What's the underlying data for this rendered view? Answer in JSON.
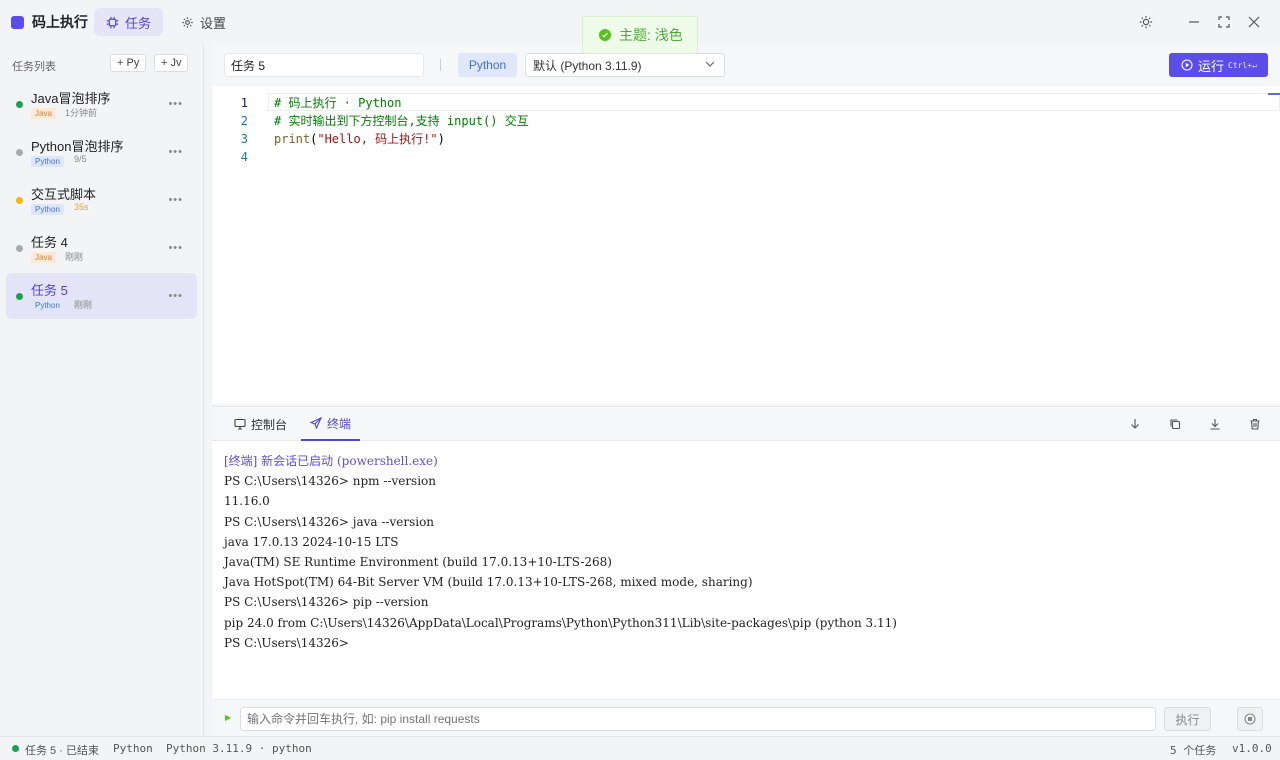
{
  "app": {
    "title": "码上执行"
  },
  "nav": {
    "tabs": [
      {
        "label": "任务",
        "icon": "cpu-icon",
        "active": true
      },
      {
        "label": "设置",
        "icon": "gear-icon",
        "active": false
      }
    ]
  },
  "toast": {
    "text": "主题: 浅色"
  },
  "sidebar": {
    "header": "任务列表",
    "add_python": "+ Py",
    "add_java": "+ Jv",
    "tasks": [
      {
        "name": "Java冒泡排序",
        "lang": "Java",
        "meta": "1分钟前",
        "status_color": "#1aa251",
        "meta_color": "#888888"
      },
      {
        "name": "Python冒泡排序",
        "lang": "Python",
        "meta": "9/5",
        "status_color": "#aaaaaa",
        "meta_color": "#888888"
      },
      {
        "name": "交互式脚本",
        "lang": "Python",
        "meta": "35s",
        "status_color": "#f5b800",
        "meta_color": "#e8a33a"
      },
      {
        "name": "任务 4",
        "lang": "Java",
        "meta": "刚刚",
        "status_color": "#aaaaaa",
        "meta_color": "#888888"
      },
      {
        "name": "任务 5",
        "lang": "Python",
        "meta": "刚刚",
        "status_color": "#1aa251",
        "meta_color": "#888888",
        "active": true
      }
    ]
  },
  "toolbar": {
    "task_name": "任务 5",
    "language": "Python",
    "runtime": "默认 (Python 3.11.9)",
    "run_label": "运行",
    "run_shortcut": "Ctrl+↵"
  },
  "editor": {
    "lines": [
      {
        "n": "1",
        "text": "# 码上执行 · Python"
      },
      {
        "n": "2",
        "text": "# 实时输出到下方控制台,支持 input() 交互"
      },
      {
        "n": "3",
        "text": "print(\"Hello, 码上执行!\")"
      },
      {
        "n": "4",
        "text": ""
      }
    ]
  },
  "console": {
    "tabs": [
      {
        "label": "控制台",
        "icon": "monitor-icon",
        "active": false
      },
      {
        "label": "终端",
        "icon": "send-icon",
        "active": true
      }
    ],
    "lines": [
      "[终端] 新会话已启动 (powershell.exe)",
      "PS C:\\Users\\14326> npm --version",
      "11.16.0",
      "PS C:\\Users\\14326> java --version",
      "java 17.0.13 2024-10-15 LTS",
      "Java(TM) SE Runtime Environment (build 17.0.13+10-LTS-268)",
      "Java HotSpot(TM) 64-Bit Server VM (build 17.0.13+10-LTS-268, mixed mode, sharing)",
      "PS C:\\Users\\14326> pip --version",
      "pip 24.0 from C:\\Users\\14326\\AppData\\Local\\Programs\\Python\\Python311\\Lib\\site-packages\\pip (python 3.11)",
      "PS C:\\Users\\14326>"
    ],
    "command_placeholder": "输入命令并回车执行, 如: pip install requests",
    "execute_label": "执行"
  },
  "status": {
    "task_state": "任务 5 · 已结束",
    "language": "Python",
    "runtime": "Python 3.11.9 · python",
    "task_count": "5 个任务",
    "version": "v1.0.0"
  },
  "colors": {
    "accent": "#5b4ee8",
    "success": "#52c41a"
  }
}
